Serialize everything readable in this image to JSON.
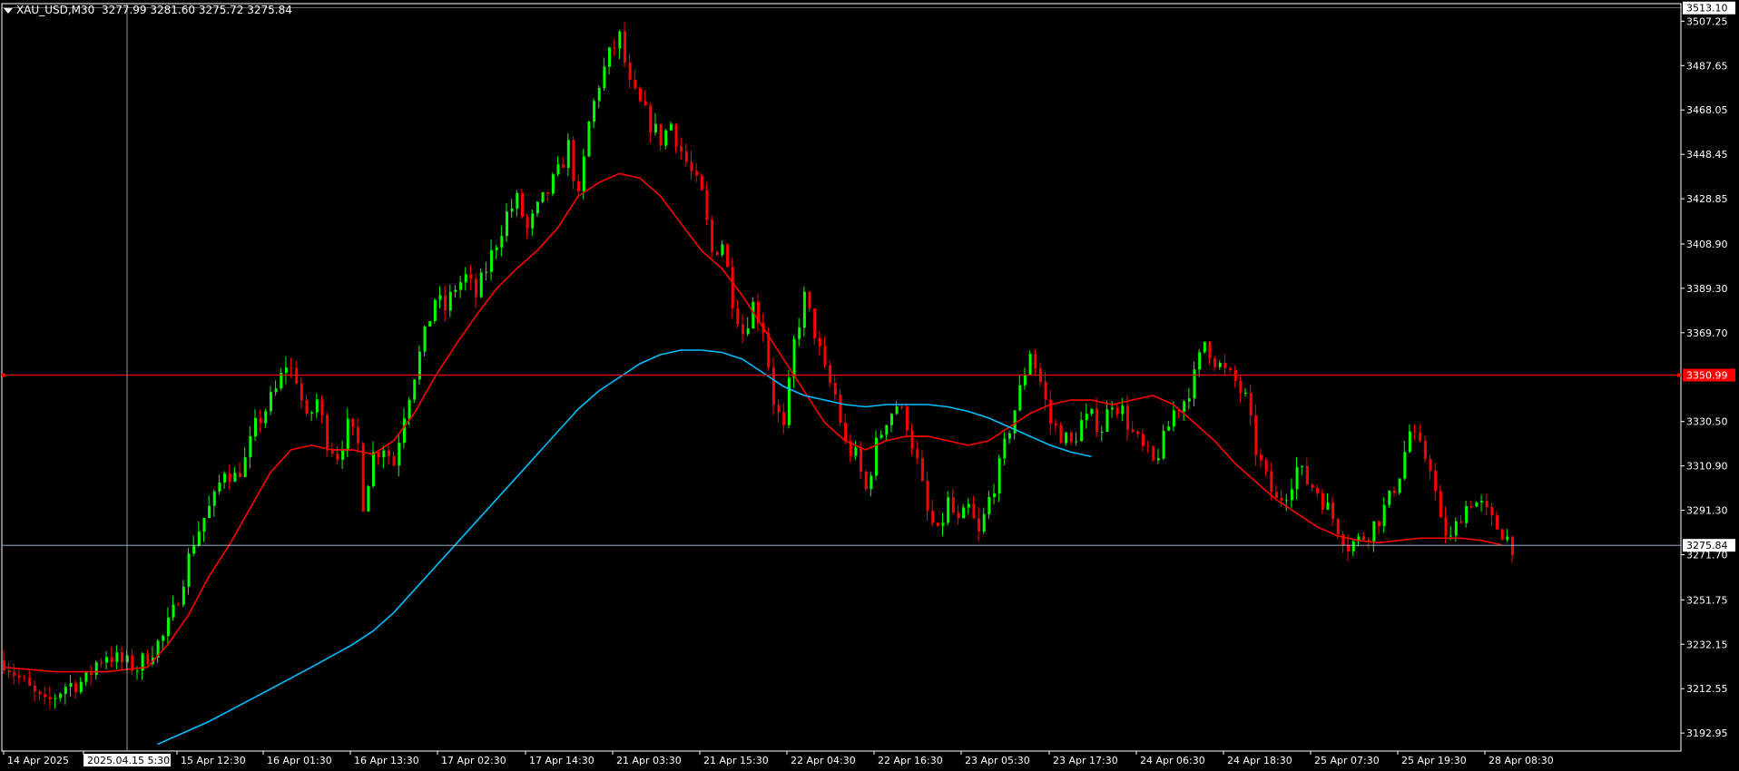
{
  "header": {
    "symbol": "XAU_USD,M30",
    "ohlc": "3277.99 3281.60 3275.72 3275.84"
  },
  "colors": {
    "background": "#000000",
    "frame": "#ffffff",
    "bull_candle": "#00ff00",
    "bear_candle": "#ff0000",
    "ma_fast": "#ff0000",
    "ma_slow": "#00bfff",
    "hline_red": "#ff0000",
    "bid_line": "#b0c4de",
    "crosshair": "#c0c0c0"
  },
  "chart_data": {
    "type": "candlestick",
    "title": "XAU_USD,M30",
    "ylim": [
      3185,
      3515
    ],
    "y_ticks": [
      "3507.25",
      "3487.65",
      "3468.05",
      "3448.45",
      "3428.85",
      "3408.90",
      "3389.30",
      "3369.70",
      "3330.50",
      "3310.90",
      "3291.30",
      "3271.70",
      "3251.75",
      "3232.15",
      "3212.55",
      "3192.95"
    ],
    "price_labels": [
      {
        "value": 3513.1,
        "label": "3513.10",
        "style": "box"
      },
      {
        "value": 3350.99,
        "label": "3350.99",
        "style": "red"
      },
      {
        "value": 3275.84,
        "label": "3275.84",
        "style": "box"
      }
    ],
    "x_ticks": [
      "14 Apr 2025",
      "2025.04.15 5:30",
      "15 Apr 12:30",
      "16 Apr 01:30",
      "16 Apr 13:30",
      "17 Apr 02:30",
      "17 Apr 14:30",
      "21 Apr 03:30",
      "21 Apr 15:30",
      "22 Apr 04:30",
      "22 Apr 16:30",
      "23 Apr 05:30",
      "23 Apr 17:30",
      "24 Apr 06:30",
      "24 Apr 18:30",
      "25 Apr 07:30",
      "25 Apr 19:30",
      "28 Apr 08:30"
    ],
    "horizontal_line": 3350.99,
    "crosshair": {
      "x_label": "2025.04.15 5:30"
    },
    "price_path": [
      [
        0,
        3225
      ],
      [
        5,
        3212
      ],
      [
        8,
        3205
      ],
      [
        12,
        3214
      ],
      [
        16,
        3216
      ],
      [
        18,
        3224
      ],
      [
        20,
        3228
      ],
      [
        23,
        3224
      ],
      [
        26,
        3222
      ],
      [
        29,
        3230
      ],
      [
        31,
        3235
      ],
      [
        33,
        3246
      ],
      [
        35,
        3262
      ],
      [
        37,
        3278
      ],
      [
        39,
        3288
      ],
      [
        41,
        3296
      ],
      [
        43,
        3310
      ],
      [
        45,
        3306
      ],
      [
        47,
        3313
      ],
      [
        49,
        3328
      ],
      [
        51,
        3336
      ],
      [
        53,
        3344
      ],
      [
        55,
        3356
      ],
      [
        57,
        3350
      ],
      [
        59,
        3330
      ],
      [
        61,
        3340
      ],
      [
        63,
        3322
      ],
      [
        65,
        3316
      ],
      [
        67,
        3328
      ],
      [
        69,
        3320
      ],
      [
        70,
        3295
      ],
      [
        72,
        3316
      ],
      [
        74,
        3320
      ],
      [
        76,
        3312
      ],
      [
        78,
        3335
      ],
      [
        80,
        3352
      ],
      [
        82,
        3368
      ],
      [
        84,
        3385
      ],
      [
        86,
        3380
      ],
      [
        88,
        3390
      ],
      [
        90,
        3394
      ],
      [
        92,
        3386
      ],
      [
        94,
        3398
      ],
      [
        96,
        3410
      ],
      [
        98,
        3422
      ],
      [
        100,
        3428
      ],
      [
        102,
        3415
      ],
      [
        104,
        3424
      ],
      [
        106,
        3432
      ],
      [
        108,
        3440
      ],
      [
        110,
        3452
      ],
      [
        112,
        3428
      ],
      [
        114,
        3462
      ],
      [
        116,
        3480
      ],
      [
        118,
        3492
      ],
      [
        120,
        3500
      ],
      [
        122,
        3478
      ],
      [
        124,
        3470
      ],
      [
        126,
        3462
      ],
      [
        128,
        3455
      ],
      [
        130,
        3462
      ],
      [
        132,
        3450
      ],
      [
        134,
        3440
      ],
      [
        136,
        3430
      ],
      [
        138,
        3405
      ],
      [
        140,
        3410
      ],
      [
        142,
        3385
      ],
      [
        144,
        3370
      ],
      [
        146,
        3382
      ],
      [
        148,
        3372
      ],
      [
        150,
        3340
      ],
      [
        152,
        3326
      ],
      [
        154,
        3365
      ],
      [
        156,
        3385
      ],
      [
        158,
        3370
      ],
      [
        160,
        3352
      ],
      [
        162,
        3342
      ],
      [
        164,
        3320
      ],
      [
        166,
        3315
      ],
      [
        168,
        3300
      ],
      [
        170,
        3320
      ],
      [
        172,
        3332
      ],
      [
        174,
        3338
      ],
      [
        176,
        3330
      ],
      [
        178,
        3312
      ],
      [
        180,
        3290
      ],
      [
        182,
        3280
      ],
      [
        184,
        3295
      ],
      [
        186,
        3285
      ],
      [
        188,
        3292
      ],
      [
        190,
        3280
      ],
      [
        192,
        3296
      ],
      [
        194,
        3310
      ],
      [
        196,
        3328
      ],
      [
        198,
        3344
      ],
      [
        200,
        3362
      ],
      [
        202,
        3348
      ],
      [
        204,
        3330
      ],
      [
        206,
        3325
      ],
      [
        208,
        3320
      ],
      [
        210,
        3330
      ],
      [
        212,
        3332
      ],
      [
        214,
        3328
      ],
      [
        216,
        3340
      ],
      [
        218,
        3335
      ],
      [
        220,
        3325
      ],
      [
        222,
        3318
      ],
      [
        224,
        3312
      ],
      [
        226,
        3322
      ],
      [
        228,
        3335
      ],
      [
        230,
        3340
      ],
      [
        232,
        3350
      ],
      [
        234,
        3366
      ],
      [
        236,
        3358
      ],
      [
        238,
        3352
      ],
      [
        240,
        3348
      ],
      [
        242,
        3340
      ],
      [
        244,
        3318
      ],
      [
        246,
        3305
      ],
      [
        248,
        3295
      ],
      [
        250,
        3300
      ],
      [
        252,
        3310
      ],
      [
        254,
        3304
      ],
      [
        256,
        3300
      ],
      [
        258,
        3292
      ],
      [
        260,
        3284
      ],
      [
        262,
        3276
      ],
      [
        264,
        3278
      ],
      [
        266,
        3282
      ],
      [
        268,
        3288
      ],
      [
        270,
        3296
      ],
      [
        272,
        3308
      ],
      [
        274,
        3326
      ],
      [
        276,
        3318
      ],
      [
        278,
        3312
      ],
      [
        280,
        3285
      ],
      [
        282,
        3278
      ],
      [
        284,
        3290
      ],
      [
        286,
        3296
      ],
      [
        288,
        3293
      ],
      [
        290,
        3286
      ],
      [
        292,
        3282
      ],
      [
        294,
        3276
      ]
    ],
    "series": [
      {
        "name": "",
        "color": "#ff0000",
        "values": [
          [
            0,
            3222
          ],
          [
            10,
            3220
          ],
          [
            20,
            3220
          ],
          [
            28,
            3222
          ],
          [
            32,
            3232
          ],
          [
            36,
            3245
          ],
          [
            40,
            3262
          ],
          [
            44,
            3276
          ],
          [
            48,
            3292
          ],
          [
            52,
            3308
          ],
          [
            56,
            3318
          ],
          [
            60,
            3320
          ],
          [
            64,
            3318
          ],
          [
            68,
            3318
          ],
          [
            72,
            3316
          ],
          [
            76,
            3322
          ],
          [
            80,
            3334
          ],
          [
            84,
            3350
          ],
          [
            88,
            3364
          ],
          [
            92,
            3377
          ],
          [
            96,
            3389
          ],
          [
            100,
            3398
          ],
          [
            104,
            3406
          ],
          [
            108,
            3416
          ],
          [
            112,
            3430
          ],
          [
            116,
            3436
          ],
          [
            120,
            3440
          ],
          [
            124,
            3438
          ],
          [
            128,
            3430
          ],
          [
            132,
            3418
          ],
          [
            136,
            3406
          ],
          [
            140,
            3398
          ],
          [
            144,
            3386
          ],
          [
            148,
            3372
          ],
          [
            152,
            3358
          ],
          [
            156,
            3344
          ],
          [
            160,
            3330
          ],
          [
            164,
            3322
          ],
          [
            168,
            3318
          ],
          [
            172,
            3322
          ],
          [
            176,
            3324
          ],
          [
            180,
            3324
          ],
          [
            184,
            3322
          ],
          [
            188,
            3320
          ],
          [
            192,
            3322
          ],
          [
            196,
            3328
          ],
          [
            200,
            3334
          ],
          [
            204,
            3338
          ],
          [
            208,
            3340
          ],
          [
            212,
            3340
          ],
          [
            216,
            3338
          ],
          [
            220,
            3340
          ],
          [
            224,
            3342
          ],
          [
            228,
            3338
          ],
          [
            232,
            3330
          ],
          [
            236,
            3322
          ],
          [
            240,
            3312
          ],
          [
            244,
            3304
          ],
          [
            248,
            3296
          ],
          [
            252,
            3290
          ],
          [
            256,
            3284
          ],
          [
            260,
            3280
          ],
          [
            264,
            3278
          ],
          [
            268,
            3277
          ],
          [
            272,
            3278
          ],
          [
            276,
            3279
          ],
          [
            280,
            3279
          ],
          [
            284,
            3279
          ],
          [
            288,
            3278
          ],
          [
            292,
            3276
          ]
        ]
      },
      {
        "name": "",
        "color": "#00bfff",
        "values": [
          [
            30,
            3188
          ],
          [
            40,
            3198
          ],
          [
            50,
            3210
          ],
          [
            60,
            3222
          ],
          [
            68,
            3232
          ],
          [
            72,
            3238
          ],
          [
            76,
            3246
          ],
          [
            80,
            3256
          ],
          [
            84,
            3266
          ],
          [
            88,
            3276
          ],
          [
            92,
            3286
          ],
          [
            96,
            3296
          ],
          [
            100,
            3306
          ],
          [
            104,
            3316
          ],
          [
            108,
            3326
          ],
          [
            112,
            3336
          ],
          [
            116,
            3344
          ],
          [
            120,
            3350
          ],
          [
            124,
            3356
          ],
          [
            128,
            3360
          ],
          [
            132,
            3362
          ],
          [
            136,
            3362
          ],
          [
            140,
            3361
          ],
          [
            144,
            3358
          ],
          [
            148,
            3352
          ],
          [
            152,
            3346
          ],
          [
            156,
            3342
          ],
          [
            160,
            3340
          ],
          [
            164,
            3338
          ],
          [
            168,
            3337
          ],
          [
            172,
            3338
          ],
          [
            176,
            3338
          ],
          [
            180,
            3338
          ],
          [
            184,
            3337
          ],
          [
            188,
            3335
          ],
          [
            192,
            3332
          ],
          [
            196,
            3328
          ],
          [
            200,
            3324
          ],
          [
            204,
            3320
          ],
          [
            208,
            3317
          ],
          [
            212,
            3315
          ]
        ]
      }
    ]
  }
}
